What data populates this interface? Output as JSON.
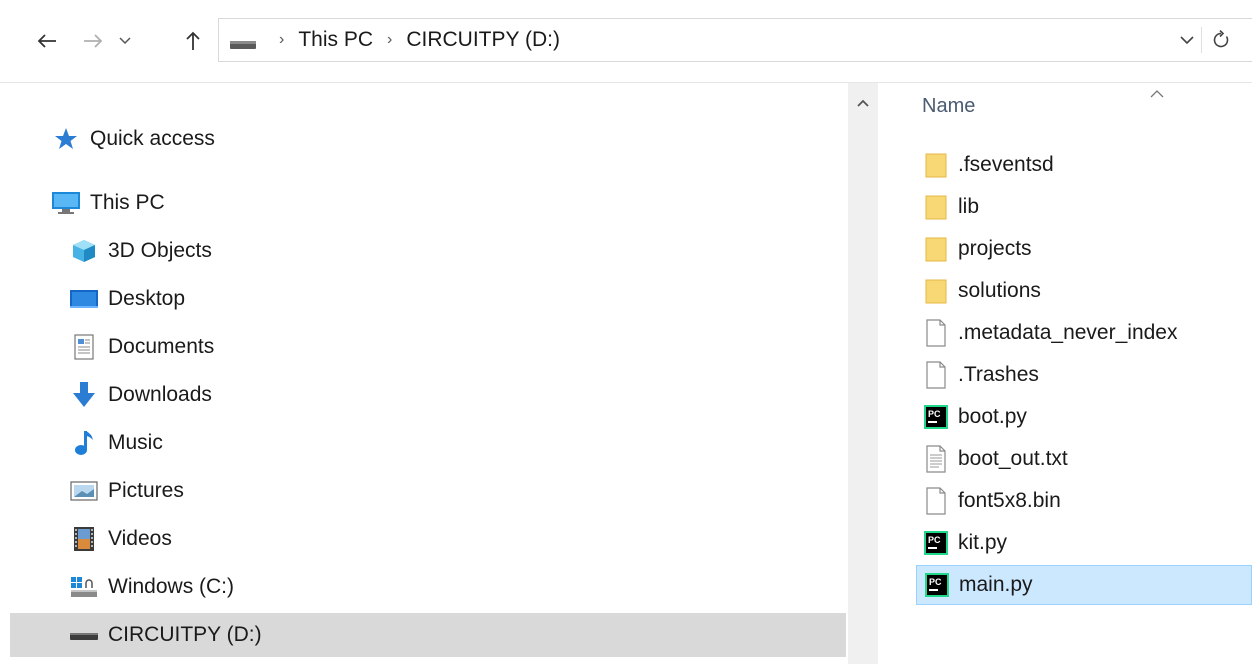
{
  "address": {
    "breadcrumbs": [
      "This PC",
      "CIRCUITPY (D:)"
    ]
  },
  "nav": {
    "items": [
      {
        "label": "Quick access",
        "icon": "quick-access-star-icon"
      },
      {
        "label": "This PC",
        "icon": "computer-icon"
      },
      {
        "label": "3D Objects",
        "icon": "3d-objects-icon"
      },
      {
        "label": "Desktop",
        "icon": "desktop-icon"
      },
      {
        "label": "Documents",
        "icon": "documents-icon"
      },
      {
        "label": "Downloads",
        "icon": "downloads-icon"
      },
      {
        "label": "Music",
        "icon": "music-icon"
      },
      {
        "label": "Pictures",
        "icon": "pictures-icon"
      },
      {
        "label": "Videos",
        "icon": "videos-icon"
      },
      {
        "label": "Windows (C:)",
        "icon": "windows-drive-icon"
      },
      {
        "label": "CIRCUITPY (D:)",
        "icon": "usb-drive-icon",
        "selected": true
      }
    ]
  },
  "content": {
    "column_header": "Name",
    "files": [
      {
        "name": ".fseventsd",
        "type": "folder"
      },
      {
        "name": "lib",
        "type": "folder"
      },
      {
        "name": "projects",
        "type": "folder"
      },
      {
        "name": "solutions",
        "type": "folder"
      },
      {
        "name": ".metadata_never_index",
        "type": "file"
      },
      {
        "name": ".Trashes",
        "type": "file"
      },
      {
        "name": "boot.py",
        "type": "pycharm"
      },
      {
        "name": "boot_out.txt",
        "type": "text"
      },
      {
        "name": "font5x8.bin",
        "type": "file"
      },
      {
        "name": "kit.py",
        "type": "pycharm"
      },
      {
        "name": "main.py",
        "type": "pycharm",
        "selected": true
      }
    ]
  },
  "colors": {
    "selection_bg": "#cce8ff",
    "selection_border": "#99d1ff",
    "nav_selected_bg": "#d9d9d9",
    "folder": "#f8d775"
  }
}
